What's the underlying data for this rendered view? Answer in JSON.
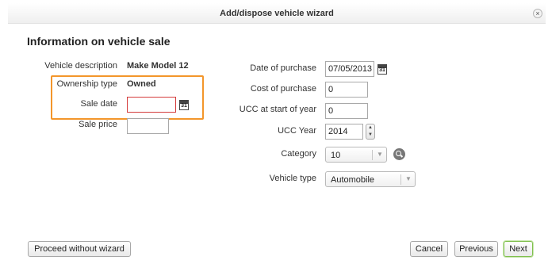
{
  "dialog": {
    "title": "Add/dispose vehicle wizard",
    "close_glyph": "×"
  },
  "section": {
    "title": "Information on vehicle sale"
  },
  "left": {
    "vehicle_description_label": "Vehicle description",
    "vehicle_description_value": "Make Model 12",
    "ownership_type_label": "Ownership type",
    "ownership_type_value": "Owned",
    "sale_date_label": "Sale date",
    "sale_date_value": "",
    "sale_price_label": "Sale price",
    "sale_price_value": ""
  },
  "right": {
    "date_of_purchase_label": "Date of purchase",
    "date_of_purchase_value": "07/05/2013",
    "cost_of_purchase_label": "Cost of purchase",
    "cost_of_purchase_value": "0",
    "ucc_start_label": "UCC at start of year",
    "ucc_start_value": "0",
    "ucc_year_label": "UCC Year",
    "ucc_year_value": "2014",
    "category_label": "Category",
    "category_value": "10",
    "vehicle_type_label": "Vehicle type",
    "vehicle_type_value": "Automobile"
  },
  "calendar_icon_text": "31",
  "spinner": {
    "up": "▲",
    "down": "▼"
  },
  "select_arrow": "▼",
  "buttons": {
    "proceed_without_wizard": "Proceed without wizard",
    "cancel": "Cancel",
    "previous": "Previous",
    "next": "Next"
  },
  "colors": {
    "highlight": "#f3962b",
    "error_border": "#d43b3b",
    "primary_button_border": "#7fbf4d"
  },
  "icons": {
    "calendar": "calendar-icon",
    "search": "search-icon",
    "close": "close-icon"
  }
}
